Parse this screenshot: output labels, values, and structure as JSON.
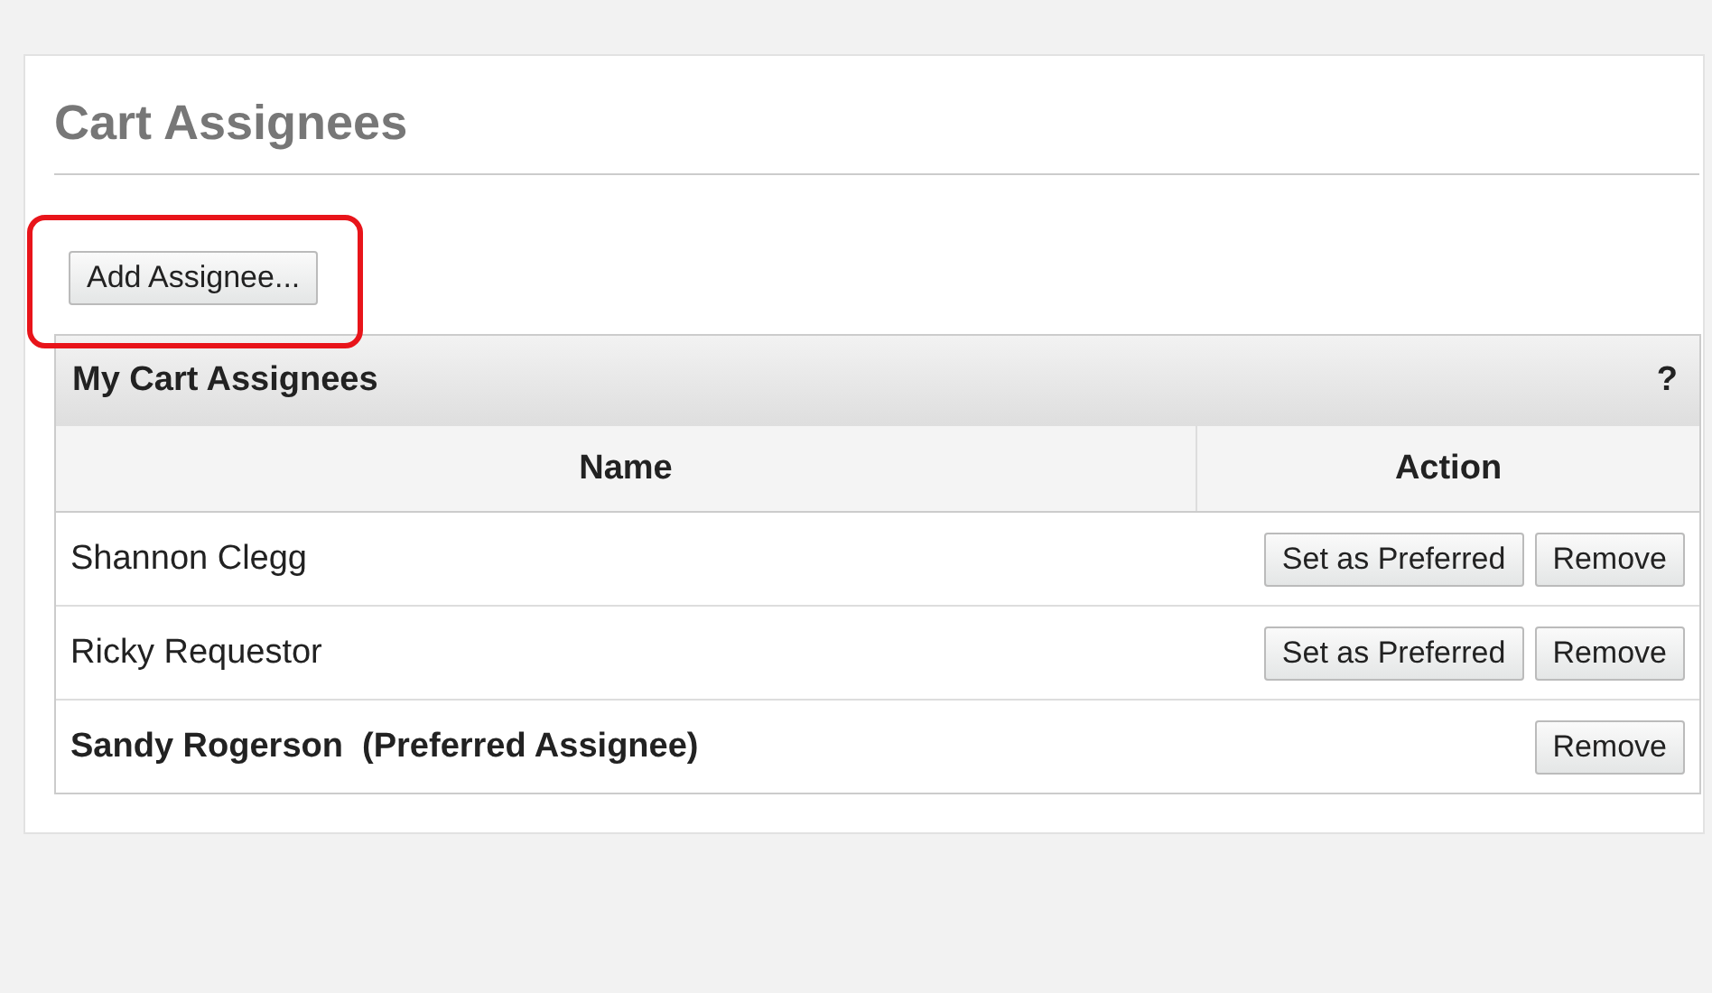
{
  "title": "Cart Assignees",
  "add_button": "Add Assignee...",
  "highlight": true,
  "table": {
    "title": "My Cart Assignees",
    "help": "?",
    "columns": [
      "Name",
      "Action"
    ],
    "rows": [
      {
        "name": "Shannon Clegg",
        "preferred": false,
        "actions": [
          "Set as Preferred",
          "Remove"
        ]
      },
      {
        "name": "Ricky Requestor",
        "preferred": false,
        "actions": [
          "Set as Preferred",
          "Remove"
        ]
      },
      {
        "name": "Sandy Rogerson",
        "preferred": true,
        "note": "(Preferred Assignee)",
        "actions": [
          "Remove"
        ]
      }
    ]
  }
}
